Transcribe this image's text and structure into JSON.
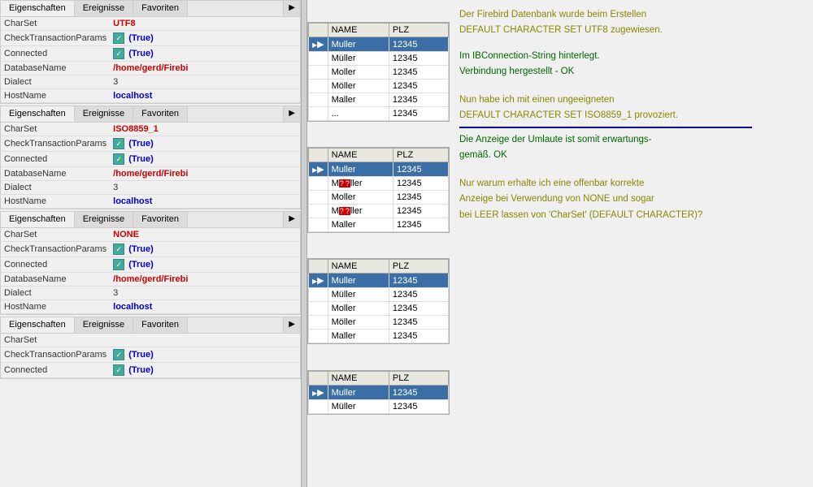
{
  "tabs": {
    "eigenschaften": "Eigenschaften",
    "ereignisse": "Ereignisse",
    "favoriten": "Favoriten",
    "arrow": "▶"
  },
  "blocks": [
    {
      "id": "block1",
      "charset": "UTF8",
      "charset_color": "red",
      "checkTransactionParams": "(True)",
      "connected": "(True)",
      "databaseName": "/home/gerd/Firebi",
      "dialect": "3",
      "hostname": "localhost",
      "tableRows": [
        {
          "name": "Muller",
          "plz": "12345",
          "selected": true
        },
        {
          "name": "Müller",
          "plz": "12345",
          "selected": false
        },
        {
          "name": "Moller",
          "plz": "12345",
          "selected": false
        },
        {
          "name": "Möller",
          "plz": "12345",
          "selected": false
        },
        {
          "name": "Maller",
          "plz": "12345",
          "selected": false
        },
        {
          "name": "...",
          "plz": "12345",
          "selected": false
        }
      ]
    },
    {
      "id": "block2",
      "charset": "ISO8859_1",
      "charset_color": "red",
      "checkTransactionParams": "(True)",
      "connected": "(True)",
      "databaseName": "/home/gerd/Firebi",
      "dialect": "3",
      "hostname": "localhost",
      "tableRows": [
        {
          "name": "Muller",
          "plz": "12345",
          "selected": true
        },
        {
          "name": "M??ller",
          "plz": "12345",
          "selected": false
        },
        {
          "name": "Moller",
          "plz": "12345",
          "selected": false
        },
        {
          "name": "M??ller",
          "plz": "12345",
          "selected": false
        },
        {
          "name": "Maller",
          "plz": "12345",
          "selected": false
        }
      ]
    },
    {
      "id": "block3",
      "charset": "NONE",
      "charset_color": "red",
      "checkTransactionParams": "(True)",
      "connected": "(True)",
      "databaseName": "/home/gerd/Firebi",
      "dialect": "3",
      "hostname": "localhost",
      "tableRows": [
        {
          "name": "Muller",
          "plz": "12345",
          "selected": true
        },
        {
          "name": "Müller",
          "plz": "12345",
          "selected": false
        },
        {
          "name": "Moller",
          "plz": "12345",
          "selected": false
        },
        {
          "name": "Möller",
          "plz": "12345",
          "selected": false
        },
        {
          "name": "Maller",
          "plz": "12345",
          "selected": false
        }
      ]
    },
    {
      "id": "block4",
      "charset": "",
      "charset_color": "normal",
      "checkTransactionParams": "(True)",
      "connected": "(True)",
      "databaseName": "",
      "dialect": "",
      "hostname": "",
      "tableRows": [
        {
          "name": "Muller",
          "plz": "12345",
          "selected": true
        },
        {
          "name": "Müller",
          "plz": "12345",
          "selected": false
        }
      ]
    }
  ],
  "comments": [
    {
      "lines": [
        {
          "text": "Der Firebird Datenbank wurde beim Erstellen",
          "class": "comment-yellow"
        },
        {
          "text": "DEFAULT CHARACTER SET UTF8 zugewiesen.",
          "class": "comment-yellow"
        }
      ],
      "extra": [
        {
          "text": "Im IBConnection-String hinterlegt.",
          "class": "comment-green"
        },
        {
          "text": "Verbindung hergestellt - OK",
          "class": "comment-green"
        }
      ],
      "separator": false
    },
    {
      "lines": [
        {
          "text": "Nun habe ich mit einen ungeeigneten",
          "class": "comment-yellow"
        },
        {
          "text": "DEFAULT CHARACTER SET ISO8859_1 provoziert.",
          "class": "comment-yellow"
        }
      ],
      "extra": [
        {
          "text": "Die Anzeige der Umlaute ist somit erwartungs-",
          "class": "comment-green"
        },
        {
          "text": "gemäß. OK",
          "class": "comment-green"
        }
      ],
      "separator": true
    },
    {
      "lines": [
        {
          "text": "Nur warum erhalte ich eine offenbar korrekte",
          "class": "comment-yellow"
        },
        {
          "text": "Anzeige bei Verwendung von NONE und sogar",
          "class": "comment-yellow"
        },
        {
          "text": "bei LEER lassen von 'CharSet' (DEFAULT CHARACTER)?",
          "class": "comment-yellow"
        }
      ],
      "extra": [],
      "separator": false
    }
  ],
  "columns": {
    "name": "NAME",
    "plz": "PLZ"
  }
}
